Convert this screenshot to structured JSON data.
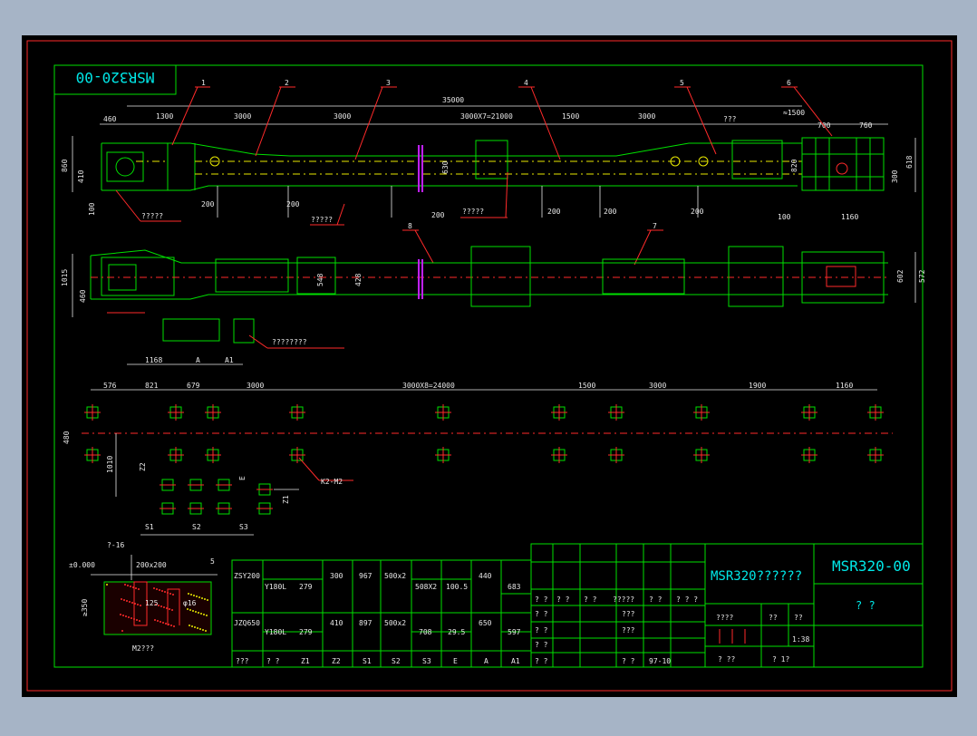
{
  "drawing_code": "MSR320-00",
  "title_text": "MSR320??????",
  "part_numbers": [
    "1",
    "2",
    "3",
    "4",
    "5",
    "6",
    "7",
    "8"
  ],
  "elevation": {
    "overall": "35000",
    "top_dims": [
      "460",
      "1300",
      "3000",
      "3000",
      "3000X7=21000",
      "1500",
      "3000",
      "???",
      "≈1500",
      "700",
      "760"
    ],
    "left_dims": [
      "860",
      "410",
      "100"
    ],
    "right_dims": [
      "820",
      "618",
      "300"
    ],
    "inner_dims": [
      "630"
    ],
    "bottom_dims": [
      "200",
      "200",
      "200",
      "200",
      "200",
      "200",
      "100",
      "1160"
    ],
    "callouts": [
      "?????",
      "?????",
      "?????"
    ]
  },
  "plan": {
    "left_dims": [
      "1015",
      "460"
    ],
    "right_dims": [
      "602",
      "572"
    ],
    "inner_dims": [
      "548",
      "428"
    ],
    "bottom_dims": [
      "1168",
      "A",
      "A1"
    ],
    "callout": "????????"
  },
  "foundation": {
    "top_dims": [
      "576",
      "821",
      "679",
      "3000",
      "3000X8=24000",
      "1500",
      "3000",
      "1900",
      "1160"
    ],
    "left_dims": [
      "480",
      "1010"
    ],
    "group_dims": [
      "Z2",
      "E",
      "Z1",
      "S1",
      "S2",
      "S3"
    ],
    "callout": "K2-M2"
  },
  "detail": {
    "labels": [
      "?-16",
      "±0.000",
      "200x200",
      "5",
      "125",
      "φ16",
      "≥350"
    ],
    "caption": "M2???"
  },
  "table": {
    "rows": [
      [
        "ZSY200",
        "Y180L",
        "279",
        "300",
        "967",
        "500x2",
        "508X2",
        "100.5",
        "440",
        "683"
      ],
      [
        "JZQ650",
        "Y180L",
        "279",
        "410",
        "897",
        "500x2",
        "708",
        "29.5",
        "650",
        "597"
      ]
    ],
    "headers": [
      "???",
      "? ?",
      "Z1",
      "Z2",
      "S1",
      "S2",
      "S3",
      "E",
      "A",
      "A1"
    ]
  },
  "title_block": {
    "sig_labels": [
      "? ?",
      "? ?",
      "? ?",
      "?????",
      "? ?",
      "? ? ?"
    ],
    "sig_left": [
      "? ?",
      "? ?",
      "? ?"
    ],
    "sig_mid": [
      "???",
      "???"
    ],
    "date_label": "? ?",
    "date": "97-10",
    "scale_labels": [
      "????",
      "??",
      "??"
    ],
    "scale": "1:38",
    "sheet": [
      "? ??",
      "? 1?"
    ],
    "name": "? ?"
  }
}
